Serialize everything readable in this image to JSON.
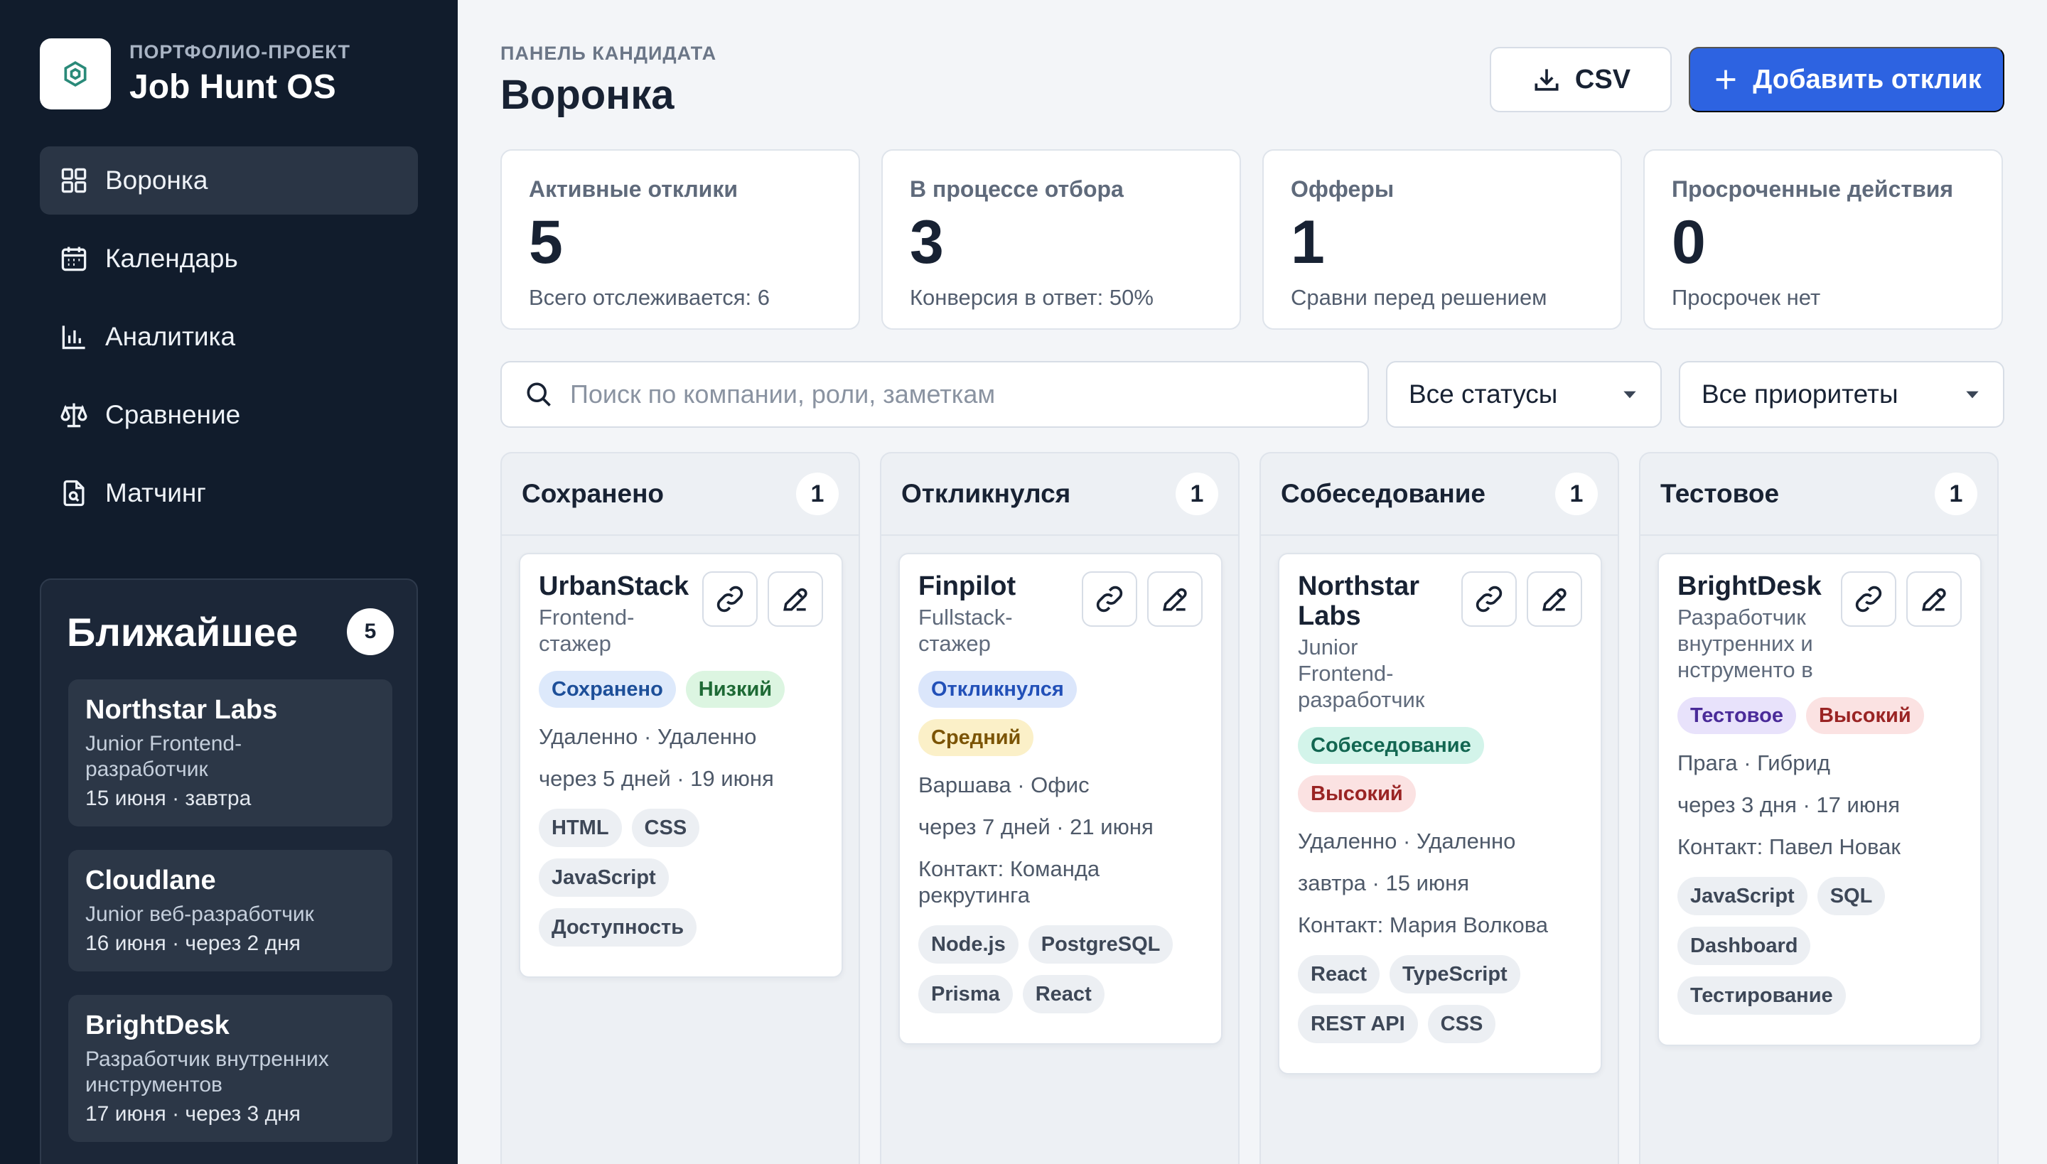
{
  "brand": {
    "subtitle": "ПОРТФОЛИО-ПРОЕКТ",
    "title": "Job Hunt OS"
  },
  "nav": [
    {
      "label": "Воронка",
      "icon": "grid-icon",
      "active": true
    },
    {
      "label": "Календарь",
      "icon": "calendar-icon"
    },
    {
      "label": "Аналитика",
      "icon": "bar-chart-icon"
    },
    {
      "label": "Сравнение",
      "icon": "scale-icon"
    },
    {
      "label": "Матчинг",
      "icon": "document-search-icon"
    }
  ],
  "upcoming": {
    "title": "Ближайшее",
    "count": "5",
    "items": [
      {
        "company": "Northstar Labs",
        "role": "Junior Frontend-разработчик",
        "date": "15 июня · завтра"
      },
      {
        "company": "Cloudlane",
        "role": "Junior веб-разработчик",
        "date": "16 июня · через 2 дня"
      },
      {
        "company": "BrightDesk",
        "role": "Разработчик внутренних инструментов",
        "date": "17 июня · через 3 дня"
      }
    ]
  },
  "header": {
    "kicker": "ПАНЕЛЬ КАНДИДАТА",
    "title": "Воронка",
    "csv_label": "CSV",
    "add_label": "Добавить отклик"
  },
  "stats": [
    {
      "label": "Активные отклики",
      "value": "5",
      "note": "Всего отслеживается: 6"
    },
    {
      "label": "В процессе отбора",
      "value": "3",
      "note": "Конверсия в ответ: 50%"
    },
    {
      "label": "Офферы",
      "value": "1",
      "note": "Сравни перед решением"
    },
    {
      "label": "Просроченные действия",
      "value": "0",
      "note": "Просрочек нет"
    }
  ],
  "filters": {
    "search_placeholder": "Поиск по компании, роли, заметкам",
    "status_value": "Все статусы",
    "priority_value": "Все приоритеты"
  },
  "colors": {
    "accent": "#2d63e1",
    "sidebar": "#111c2c"
  },
  "columns": [
    {
      "title": "Сохранено",
      "count": "1",
      "card": {
        "company": "UrbanStack",
        "role": "Frontend-стажер",
        "status": "Сохранено",
        "priority": "Низкий",
        "location": "Удаленно · Удаленно",
        "due": "через 5 дней · 19 июня",
        "tags": [
          "HTML",
          "CSS",
          "JavaScript",
          "Доступность"
        ]
      }
    },
    {
      "title": "Откликнулся",
      "count": "1",
      "card": {
        "company": "Finpilot",
        "role": "Fullstack-стажер",
        "status": "Откликнулся",
        "priority": "Средний",
        "location": "Варшава · Офис",
        "due": "через 7 дней · 21 июня",
        "contact": "Контакт: Команда рекрутинга",
        "tags": [
          "Node.js",
          "PostgreSQL",
          "Prisma",
          "React"
        ]
      }
    },
    {
      "title": "Собеседование",
      "count": "1",
      "card": {
        "company": "Northstar Labs",
        "role": "Junior Frontend-разработчик",
        "status": "Собеседование",
        "priority": "Высокий",
        "location": "Удаленно · Удаленно",
        "due": "завтра · 15 июня",
        "contact": "Контакт: Мария Волкова",
        "tags": [
          "React",
          "TypeScript",
          "REST API",
          "CSS"
        ]
      }
    },
    {
      "title": "Тестовое",
      "count": "1",
      "card": {
        "company": "BrightDesk",
        "role": "Разработчик внутренних инструменто в",
        "status": "Тестовое",
        "priority": "Высокий",
        "location": "Прага · Гибрид",
        "due": "через 3 дня · 17 июня",
        "contact": "Контакт: Павел Новак",
        "tags": [
          "JavaScript",
          "SQL",
          "Dashboard",
          "Тестирование"
        ]
      }
    }
  ]
}
